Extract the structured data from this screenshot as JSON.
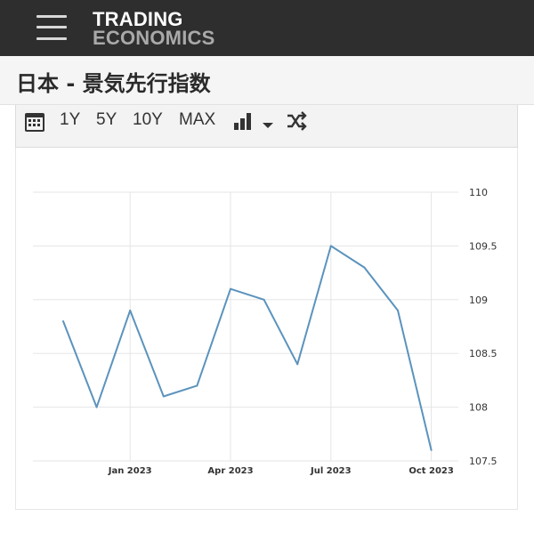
{
  "header": {
    "logo_line1": "TRADING",
    "logo_line2": "ECONOMICS"
  },
  "page_title": "日本 - 景気先行指数",
  "toolbar": {
    "buttons": [
      "1Y",
      "5Y",
      "10Y",
      "MAX"
    ]
  },
  "colors": {
    "topbar": "#2e2e2e",
    "line": "#5b93bd",
    "grid": "#e5e5e5"
  },
  "chart_data": {
    "type": "line",
    "title": "",
    "xlabel": "",
    "ylabel": "",
    "x": [
      "2022-11",
      "2022-12",
      "2023-01",
      "2023-02",
      "2023-03",
      "2023-04",
      "2023-05",
      "2023-06",
      "2023-07",
      "2023-08",
      "2023-09",
      "2023-10",
      "2023-11"
    ],
    "series": [
      {
        "values": [
          108.8,
          108.0,
          108.9,
          108.1,
          108.2,
          109.1,
          109.0,
          108.4,
          109.5,
          109.3,
          108.9,
          107.6,
          null
        ]
      }
    ],
    "x_tick_labels": [
      "Jan 2023",
      "Apr 2023",
      "Jul 2023",
      "Oct 2023"
    ],
    "y_tick_labels": [
      "110",
      "109.5",
      "109",
      "108.5",
      "108",
      "107.5"
    ],
    "ylim": [
      107.5,
      110
    ],
    "y_axis_position": "right",
    "grid": true,
    "legend": "none"
  }
}
